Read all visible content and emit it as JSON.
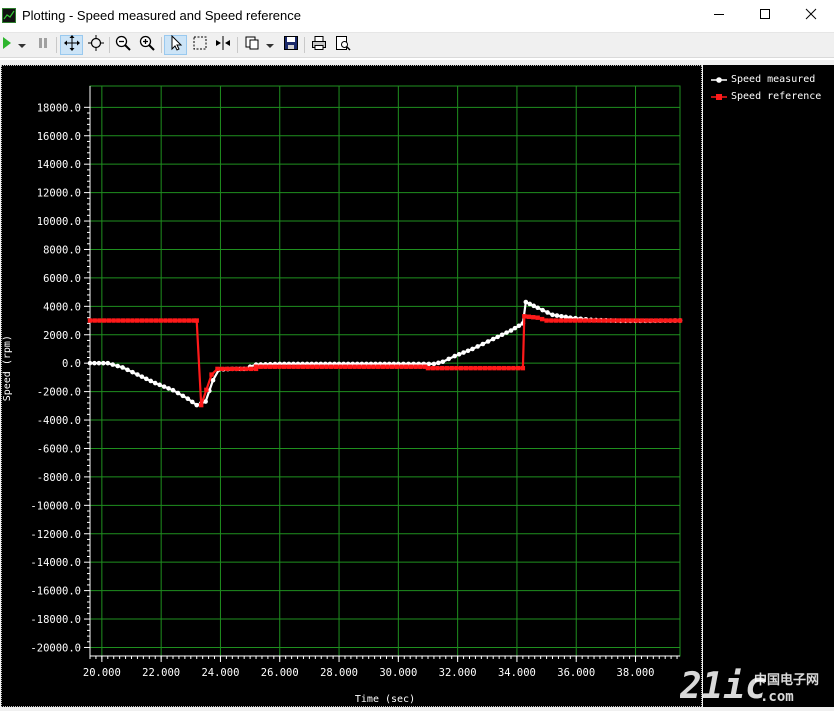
{
  "window": {
    "title": "Plotting  - Speed measured and Speed reference",
    "app_icon": "chart-app-icon",
    "controls": [
      "minimize-icon",
      "maximize-icon",
      "close-icon"
    ]
  },
  "toolbar": {
    "buttons": [
      {
        "name": "run-button",
        "icon": "play-icon"
      },
      {
        "name": "run-dropdown",
        "icon": "chevron-down-icon"
      },
      {
        "name": "pause-button",
        "icon": "pause-icon"
      },
      {
        "name": "pan-button",
        "icon": "pan-arrows-icon",
        "active": true
      },
      {
        "name": "zoom-fit-button",
        "icon": "zoom-fit-icon"
      },
      {
        "name": "zoom-out-button",
        "icon": "zoom-out-icon"
      },
      {
        "name": "zoom-in-button",
        "icon": "zoom-in-icon"
      },
      {
        "name": "select-button",
        "icon": "pointer-icon",
        "active": true
      },
      {
        "name": "box-select-button",
        "icon": "marquee-icon"
      },
      {
        "name": "cursor-button",
        "icon": "measure-cursor-icon"
      },
      {
        "name": "copy-button",
        "icon": "copy-icon"
      },
      {
        "name": "copy-dropdown",
        "icon": "chevron-down-icon"
      },
      {
        "name": "save-button",
        "icon": "save-icon"
      },
      {
        "name": "print-button",
        "icon": "print-icon"
      },
      {
        "name": "print-preview-button",
        "icon": "print-preview-icon"
      }
    ]
  },
  "watermark": {
    "text": "21ic",
    "cn": "中国电子网",
    "domain": ".com"
  },
  "chart_data": {
    "type": "line",
    "title": "",
    "xlabel": "Time (sec)",
    "ylabel": "Speed (rpm)",
    "xlim": [
      19.6,
      39.5
    ],
    "ylim": [
      -20600,
      19500
    ],
    "background": "#000000",
    "grid": true,
    "grid_color": "#1f8f1f",
    "legend_position": "right",
    "x_ticks": [
      20,
      22,
      24,
      26,
      28,
      30,
      32,
      34,
      36,
      38
    ],
    "x_tick_labels": [
      "20.000",
      "22.000",
      "24.000",
      "26.000",
      "28.000",
      "30.000",
      "32.000",
      "34.000",
      "36.000",
      "38.000"
    ],
    "y_ticks": [
      18000,
      16000,
      14000,
      12000,
      10000,
      8000,
      6000,
      4000,
      2000,
      0,
      -2000,
      -4000,
      -6000,
      -8000,
      -10000,
      -12000,
      -14000,
      -16000,
      -18000,
      -20000
    ],
    "y_tick_labels": [
      "18000.0",
      "16000.0",
      "14000.0",
      "12000.0",
      "10000.0",
      "8000.0",
      "6000.0",
      "4000.0",
      "2000.0",
      "0.0",
      "-2000.0",
      "-4000.0",
      "-6000.0",
      "-8000.0",
      "-10000.0",
      "-12000.0",
      "-14000.0",
      "-16000.0",
      "-18000.0",
      "-20000.0"
    ],
    "series": [
      {
        "name": "Speed measured",
        "color": "#ffffff",
        "marker": "circle",
        "points": [
          [
            19.6,
            0
          ],
          [
            20.2,
            0
          ],
          [
            20.7,
            -300
          ],
          [
            21.2,
            -800
          ],
          [
            21.8,
            -1400
          ],
          [
            22.4,
            -1900
          ],
          [
            22.9,
            -2500
          ],
          [
            23.2,
            -2950
          ],
          [
            23.5,
            -2700
          ],
          [
            23.75,
            -1200
          ],
          [
            23.95,
            -450
          ],
          [
            24.4,
            -400
          ],
          [
            24.8,
            -400
          ],
          [
            25.2,
            -100
          ],
          [
            26.0,
            -50
          ],
          [
            28.0,
            -50
          ],
          [
            30.0,
            -50
          ],
          [
            31.2,
            -50
          ],
          [
            31.5,
            100
          ],
          [
            31.9,
            500
          ],
          [
            32.5,
            1000
          ],
          [
            33.2,
            1700
          ],
          [
            33.8,
            2300
          ],
          [
            34.2,
            2800
          ],
          [
            34.3,
            4300
          ],
          [
            34.7,
            3900
          ],
          [
            35.2,
            3400
          ],
          [
            35.8,
            3200
          ],
          [
            36.5,
            3050
          ],
          [
            37.5,
            2980
          ],
          [
            38.5,
            2980
          ],
          [
            39.5,
            3000
          ]
        ]
      },
      {
        "name": "Speed reference",
        "color": "#ff1a1a",
        "marker": "square",
        "points": [
          [
            19.6,
            3000
          ],
          [
            23.1,
            3000
          ],
          [
            23.2,
            3000
          ],
          [
            23.35,
            -2950
          ],
          [
            23.7,
            -800
          ],
          [
            23.9,
            -400
          ],
          [
            25.2,
            -400
          ],
          [
            25.2,
            -250
          ],
          [
            30.9,
            -250
          ],
          [
            31.0,
            -350
          ],
          [
            34.2,
            -350
          ],
          [
            34.25,
            3300
          ],
          [
            34.7,
            3200
          ],
          [
            35.0,
            3000
          ],
          [
            39.5,
            3000
          ]
        ]
      }
    ]
  }
}
